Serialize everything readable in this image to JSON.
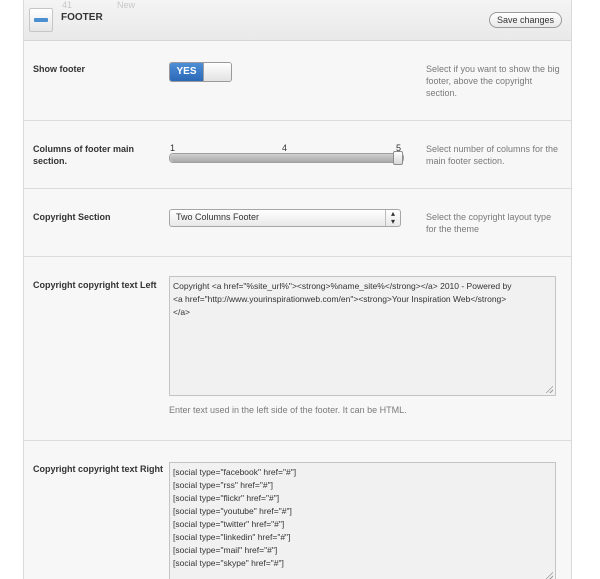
{
  "header": {
    "ghost_count": "41",
    "ghost_new": "New",
    "title": "FOOTER",
    "save_label": "Save changes"
  },
  "rows": {
    "show_footer": {
      "label": "Show footer",
      "toggle_label": "YES",
      "toggle_on": true,
      "description": "Select if you want to show the big footer, above the copyright section."
    },
    "columns": {
      "label": "Columns of footer main section.",
      "min_label": "1",
      "value_label": "4",
      "max_label": "5",
      "value": 4,
      "min": 1,
      "max": 5,
      "description": "Select number of columns for the main footer section."
    },
    "copyright_section": {
      "label": "Copyright Section",
      "selected": "Two Columns Footer",
      "description": "Select the copyright layout type for the theme"
    },
    "copyright_left": {
      "label": "Copyright copyright text Left",
      "lines": [
        "Copyright <a href=\"%site_url%\"><strong>%name_site%</strong></a> 2010 - Powered by",
        "<a href=\"http://www.yourinspirationweb.com/en\"><strong>Your Inspiration Web</strong>",
        "</a>"
      ],
      "help": "Enter text used in the left side of the footer. It can be HTML."
    },
    "copyright_right": {
      "label": "Copyright copyright text Right",
      "lines": [
        "[social type=\"facebook\" href=\"#\"]",
        "[social type=\"rss\" href=\"#\"]",
        "[social type=\"flickr\" href=\"#\"]",
        "[social type=\"youtube\" href=\"#\"]",
        "[social type=\"twitter\" href=\"#\"]",
        "[social type=\"linkedin\" href=\"#\"]",
        "[social type=\"mail\" href=\"#\"]",
        "[social type=\"skype\" href=\"#\"]"
      ]
    }
  },
  "icons": {
    "header": "footer-section-icon",
    "select_arrow": "up-down-arrows-icon",
    "resize": "resize-grip-icon"
  },
  "colors": {
    "accent": "#2b69b8",
    "panel_bg": "#f7f7f7",
    "desc_text": "#7a7a7a"
  }
}
